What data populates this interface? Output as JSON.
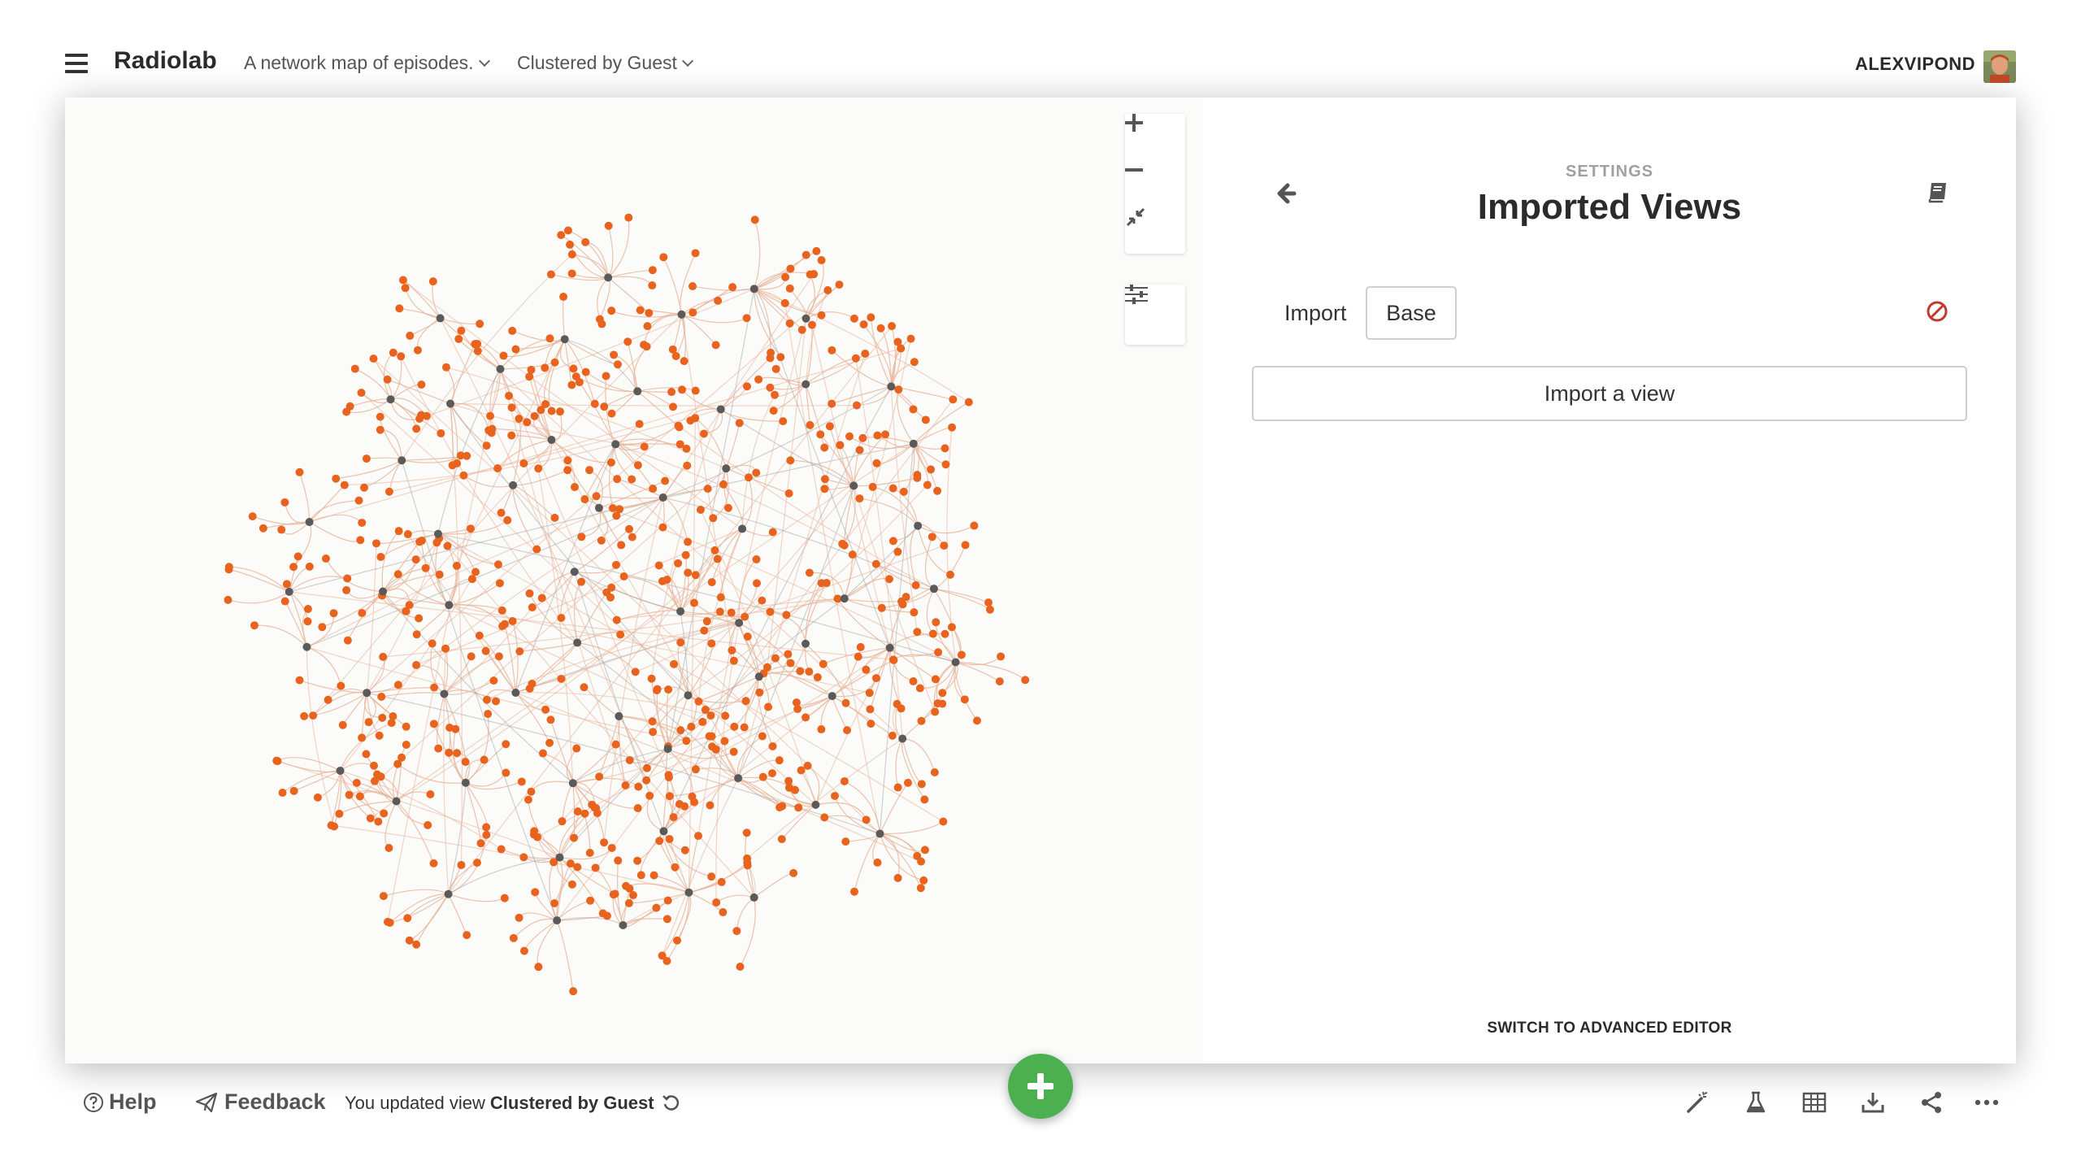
{
  "header": {
    "app_title": "Radiolab",
    "map_description": "A network map of episodes.",
    "view_name": "Clustered by Guest",
    "username": "ALEXVIPOND"
  },
  "map_controls": {
    "zoom_in": "plus-icon",
    "zoom_out": "minus-icon",
    "fit": "compress-icon",
    "filters": "sliders-icon"
  },
  "panel": {
    "section": "SETTINGS",
    "title": "Imported Views",
    "import_label": "Import",
    "imported_view": "Base",
    "import_button": "Import a view",
    "advanced_editor": "SWITCH TO ADVANCED EDITOR"
  },
  "footer": {
    "help": "Help",
    "feedback": "Feedback",
    "status_prefix": "You updated view",
    "status_view": "Clustered by Guest"
  },
  "colors": {
    "node_element": "#e8641e",
    "node_hub": "#5a5a5a",
    "edge": "#e7b49a",
    "fab": "#4caf50",
    "remove": "#c0392b"
  }
}
